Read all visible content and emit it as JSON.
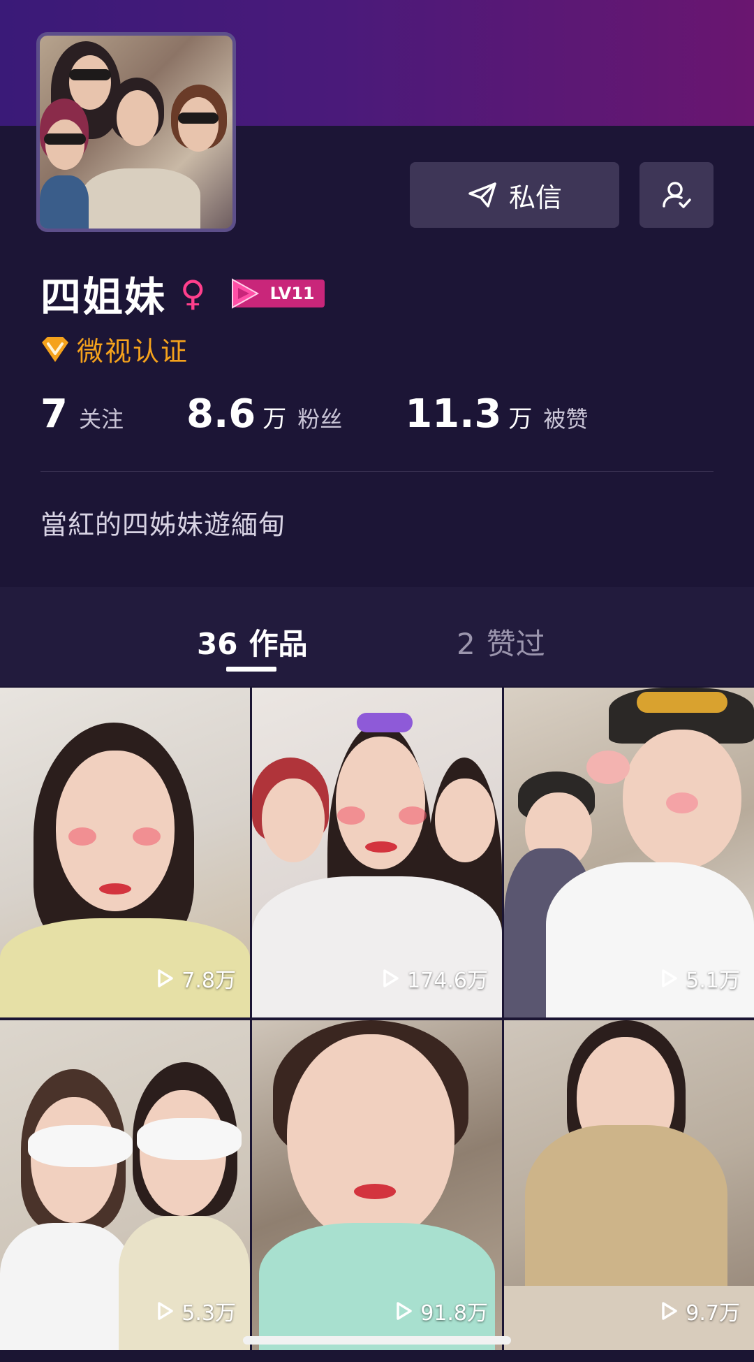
{
  "profile": {
    "username": "四姐妹",
    "gender_symbol": "♀",
    "level": "LV11",
    "verification": "微视认证",
    "bio": "當紅的四姊妹遊緬甸"
  },
  "actions": {
    "message_label": "私信"
  },
  "stats": {
    "following": {
      "value": "7",
      "unit": "",
      "label": "关注"
    },
    "fans": {
      "value": "8.6",
      "unit": "万",
      "label": "粉丝"
    },
    "likes": {
      "value": "11.3",
      "unit": "万",
      "label": "被赞"
    }
  },
  "tabs": [
    {
      "count": "36",
      "label": "作品",
      "active": true
    },
    {
      "count": "2",
      "label": "赞过",
      "active": false
    }
  ],
  "videos": [
    {
      "views": "7.8万"
    },
    {
      "views": "174.6万"
    },
    {
      "views": "5.1万"
    },
    {
      "views": "5.3万"
    },
    {
      "views": "91.8万"
    },
    {
      "views": "9.7万"
    }
  ],
  "colors": {
    "accent_pink": "#ff3f8c",
    "verify_gold": "#f5a21c",
    "background": "#1c1536"
  }
}
